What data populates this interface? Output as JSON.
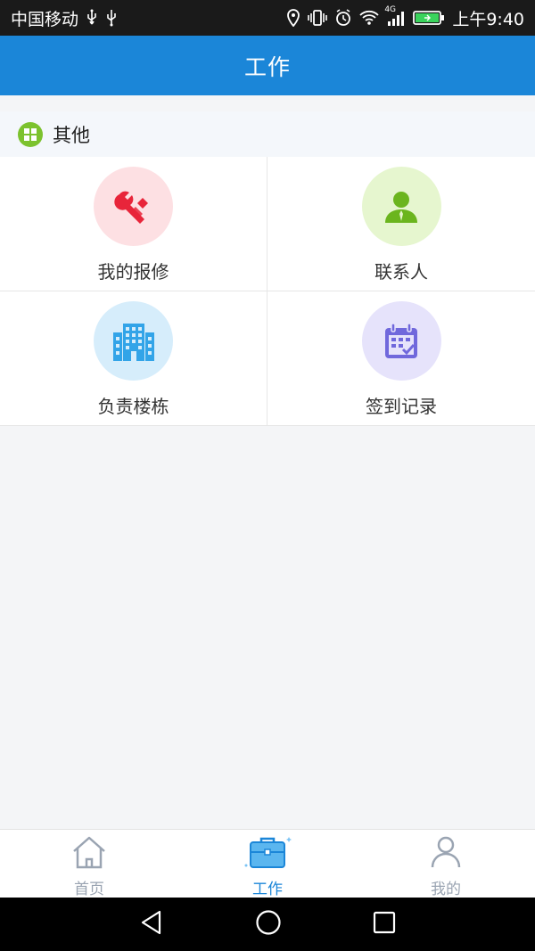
{
  "status_bar": {
    "carrier": "中国移动",
    "network": "4G",
    "time": "上午9:40"
  },
  "header": {
    "title": "工作"
  },
  "section": {
    "title": "其他"
  },
  "grid_items": [
    {
      "label": "我的报修",
      "icon": "wrench-icon",
      "bg": "#fde0e3",
      "color": "#e8253a"
    },
    {
      "label": "联系人",
      "icon": "contact-person-icon",
      "bg": "#e6f6cf",
      "color": "#6bb51e"
    },
    {
      "label": "负责楼栋",
      "icon": "building-icon",
      "bg": "#d6edfb",
      "color": "#32a4e8"
    },
    {
      "label": "签到记录",
      "icon": "calendar-check-icon",
      "bg": "#e6e3fb",
      "color": "#7068dc"
    }
  ],
  "tabs": [
    {
      "label": "首页",
      "icon": "home-icon",
      "active": false
    },
    {
      "label": "工作",
      "icon": "briefcase-icon",
      "active": true
    },
    {
      "label": "我的",
      "icon": "person-icon",
      "active": false
    }
  ],
  "colors": {
    "primary": "#1b86d8",
    "inactive_tab": "#9aa4b2",
    "section_badge": "#7cc22e"
  }
}
